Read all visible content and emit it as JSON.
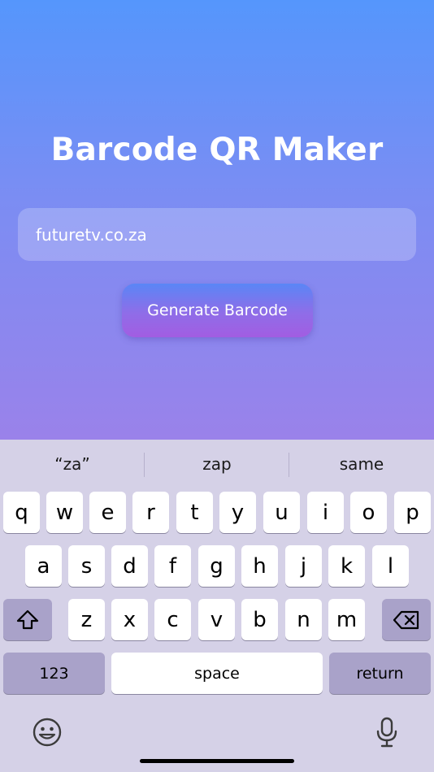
{
  "app": {
    "title": "Barcode QR Maker",
    "input_value": "futuretv.co.za",
    "generate_label": "Generate Barcode"
  },
  "keyboard": {
    "suggestions": [
      "“za”",
      "zap",
      "same"
    ],
    "row1": [
      "q",
      "w",
      "e",
      "r",
      "t",
      "y",
      "u",
      "i",
      "o",
      "p"
    ],
    "row2": [
      "a",
      "s",
      "d",
      "f",
      "g",
      "h",
      "j",
      "k",
      "l"
    ],
    "row3": [
      "z",
      "x",
      "c",
      "v",
      "b",
      "n",
      "m"
    ],
    "numbers_label": "123",
    "space_label": "space",
    "return_label": "return",
    "icons": {
      "shift": "shift-icon",
      "delete": "backspace-icon",
      "emoji": "emoji-icon",
      "mic": "microphone-icon"
    }
  }
}
